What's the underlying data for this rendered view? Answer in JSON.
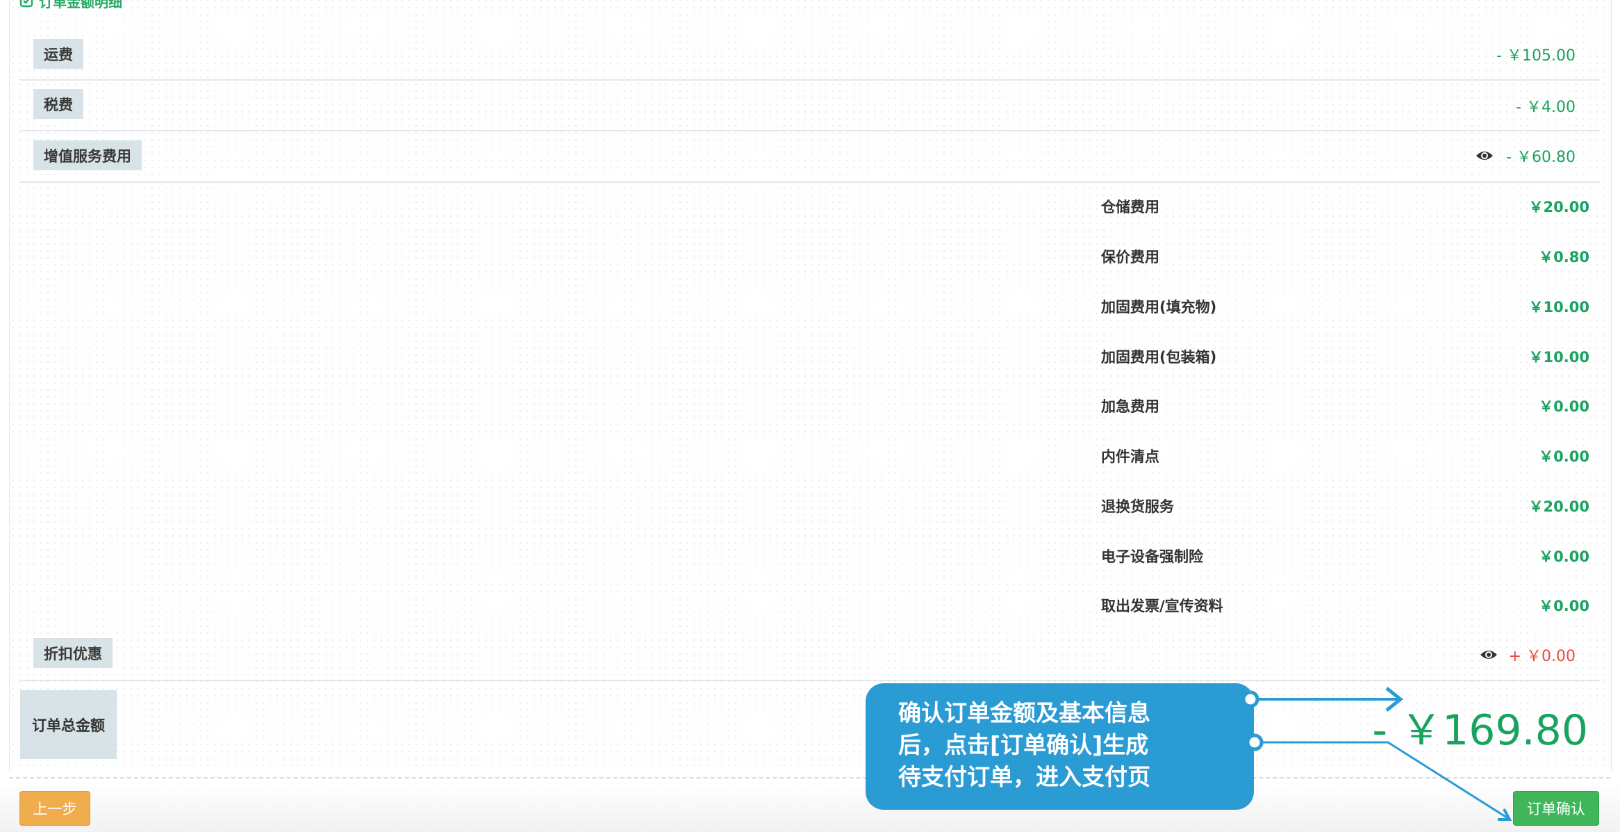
{
  "section": {
    "title": "订单金额明细"
  },
  "rows": {
    "freight": {
      "label": "运费",
      "amount": "- ￥105.00"
    },
    "tax": {
      "label": "税费",
      "amount": "- ￥4.00"
    },
    "vas": {
      "label": "增值服务费用",
      "amount": "- ￥60.80"
    },
    "discount": {
      "label": "折扣优惠",
      "amount": "+ ￥0.00"
    }
  },
  "vas_items": [
    {
      "label": "仓储费用",
      "value": "￥20.00"
    },
    {
      "label": "保价费用",
      "value": "￥0.80"
    },
    {
      "label": "加固费用(填充物)",
      "value": "￥10.00"
    },
    {
      "label": "加固费用(包装箱)",
      "value": "￥10.00"
    },
    {
      "label": "加急费用",
      "value": "￥0.00"
    },
    {
      "label": "内件清点",
      "value": "￥0.00"
    },
    {
      "label": "退换货服务",
      "value": "￥20.00"
    },
    {
      "label": "电子设备强制险",
      "value": "￥0.00"
    },
    {
      "label": "取出发票/宣传资料",
      "value": "￥0.00"
    }
  ],
  "total": {
    "label": "订单总金额",
    "value": "- ￥169.80"
  },
  "buttons": {
    "prev": "上一步",
    "confirm": "订单确认"
  },
  "callout": {
    "lines": [
      "确认订单金额及基本信息",
      "后，点击[订单确认]生成",
      "待支付订单，进入支付页"
    ]
  },
  "icons": {
    "section": "check-square-icon",
    "toggle": "eye-icon"
  },
  "colors": {
    "green": "#1aa25f",
    "red": "#e74c3c",
    "badge_bg": "#d7e3e6",
    "prev_button": "#f0ad4e",
    "confirm_button": "#3fb65a",
    "callout_bg": "#2b9bd4"
  }
}
